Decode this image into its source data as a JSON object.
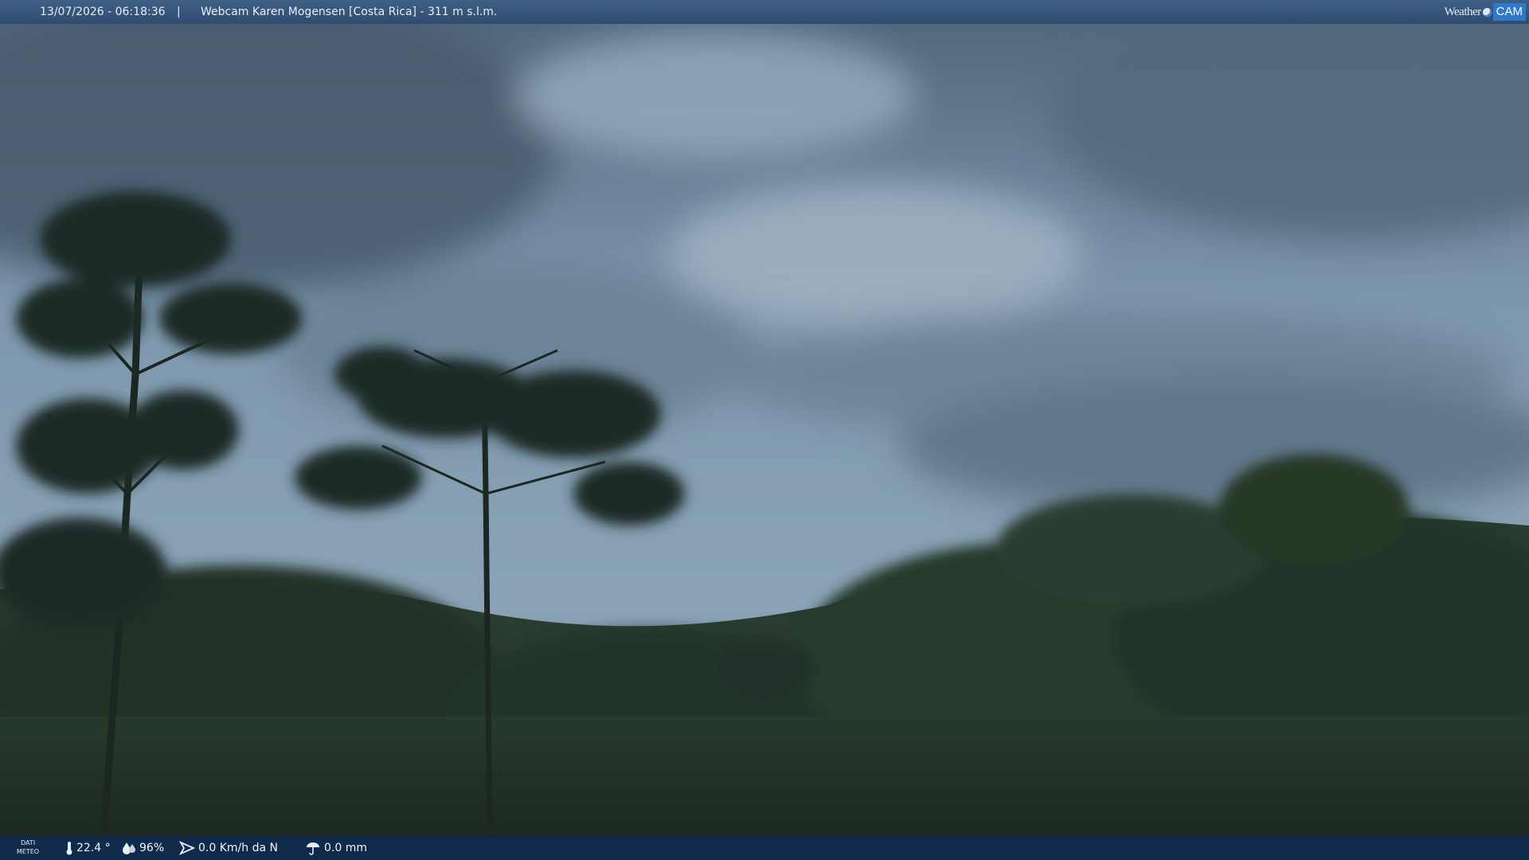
{
  "header": {
    "datetime": "13/07/2026 - 06:18:36",
    "separator": "|",
    "title": "Webcam Karen Mogensen [Costa Rica] - 311 m s.l.m.",
    "logo_weather": "Weather",
    "logo_cam": "CAM"
  },
  "footer": {
    "label_line1": "DATI",
    "label_line2": "METEO",
    "temperature": "22.4 °",
    "humidity": "96%",
    "wind": "0.0 Km/h da N",
    "rain": "0.0 mm",
    "icons": [
      "thermometer-icon",
      "humidity-icon",
      "wind-icon",
      "rain-icon"
    ]
  },
  "colors": {
    "topbar": "#34557c",
    "bottombar": "#0f2a4a",
    "sky": "#7f99ae",
    "foliage": "#1e2b22"
  }
}
